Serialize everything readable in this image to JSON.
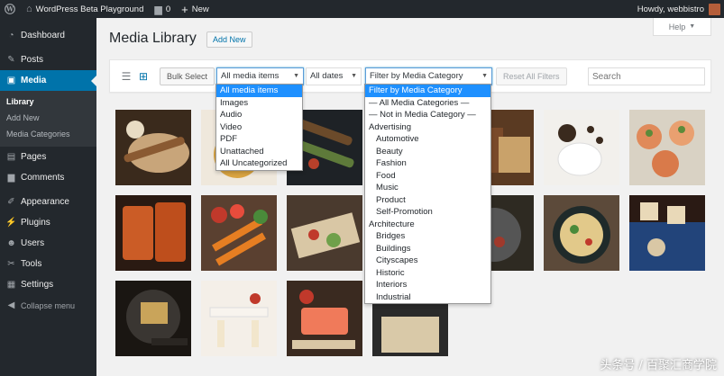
{
  "adminbar": {
    "wp_icon": "wordpress-icon",
    "site_name": "WordPress Beta Playground",
    "comments_count": "0",
    "new_label": "New",
    "howdy": "Howdy, webbistro"
  },
  "sidebar": {
    "items": [
      {
        "label": "Dashboard",
        "icon": "dashboard-icon"
      },
      {
        "label": "Posts",
        "icon": "pin-icon"
      },
      {
        "label": "Media",
        "icon": "media-icon"
      },
      {
        "label": "Pages",
        "icon": "page-icon"
      },
      {
        "label": "Comments",
        "icon": "comment-icon"
      },
      {
        "label": "Appearance",
        "icon": "brush-icon"
      },
      {
        "label": "Plugins",
        "icon": "plug-icon"
      },
      {
        "label": "Users",
        "icon": "user-icon"
      },
      {
        "label": "Tools",
        "icon": "wrench-icon"
      },
      {
        "label": "Settings",
        "icon": "settings-icon"
      },
      {
        "label": "Collapse menu",
        "icon": "collapse-icon"
      }
    ],
    "media_sub": [
      "Library",
      "Add New",
      "Media Categories"
    ]
  },
  "page": {
    "title": "Media Library",
    "add_new": "Add New",
    "help": "Help"
  },
  "toolbar": {
    "bulk_select": "Bulk Select",
    "media_type_value": "All media items",
    "dates_value": "All dates",
    "category_value": "Filter by Media Category",
    "reset": "Reset All Filters",
    "search_placeholder": "Search"
  },
  "media_type_options": [
    "All media items",
    "Images",
    "Audio",
    "Video",
    "PDF",
    "Unattached",
    "All Uncategorized"
  ],
  "category_options": [
    {
      "label": "Filter by Media Category",
      "indent": false
    },
    {
      "label": "— All Media Categories —",
      "indent": false
    },
    {
      "label": "— Not in Media Category —",
      "indent": false
    },
    {
      "label": "Advertising",
      "indent": false
    },
    {
      "label": "Automotive",
      "indent": true
    },
    {
      "label": "Beauty",
      "indent": true
    },
    {
      "label": "Fashion",
      "indent": true
    },
    {
      "label": "Food",
      "indent": true
    },
    {
      "label": "Music",
      "indent": true
    },
    {
      "label": "Product",
      "indent": true
    },
    {
      "label": "Self-Promotion",
      "indent": true
    },
    {
      "label": "Architecture",
      "indent": false
    },
    {
      "label": "Bridges",
      "indent": true
    },
    {
      "label": "Buildings",
      "indent": true
    },
    {
      "label": "Cityscapes",
      "indent": true
    },
    {
      "label": "Historic",
      "indent": true
    },
    {
      "label": "Interiors",
      "indent": true
    },
    {
      "label": "Industrial",
      "indent": true
    }
  ],
  "watermark": "头条号 / 百聚汇商学院",
  "colors": {
    "accent": "#0073aa",
    "adminbar": "#23282d",
    "highlight": "#1e90ff"
  }
}
